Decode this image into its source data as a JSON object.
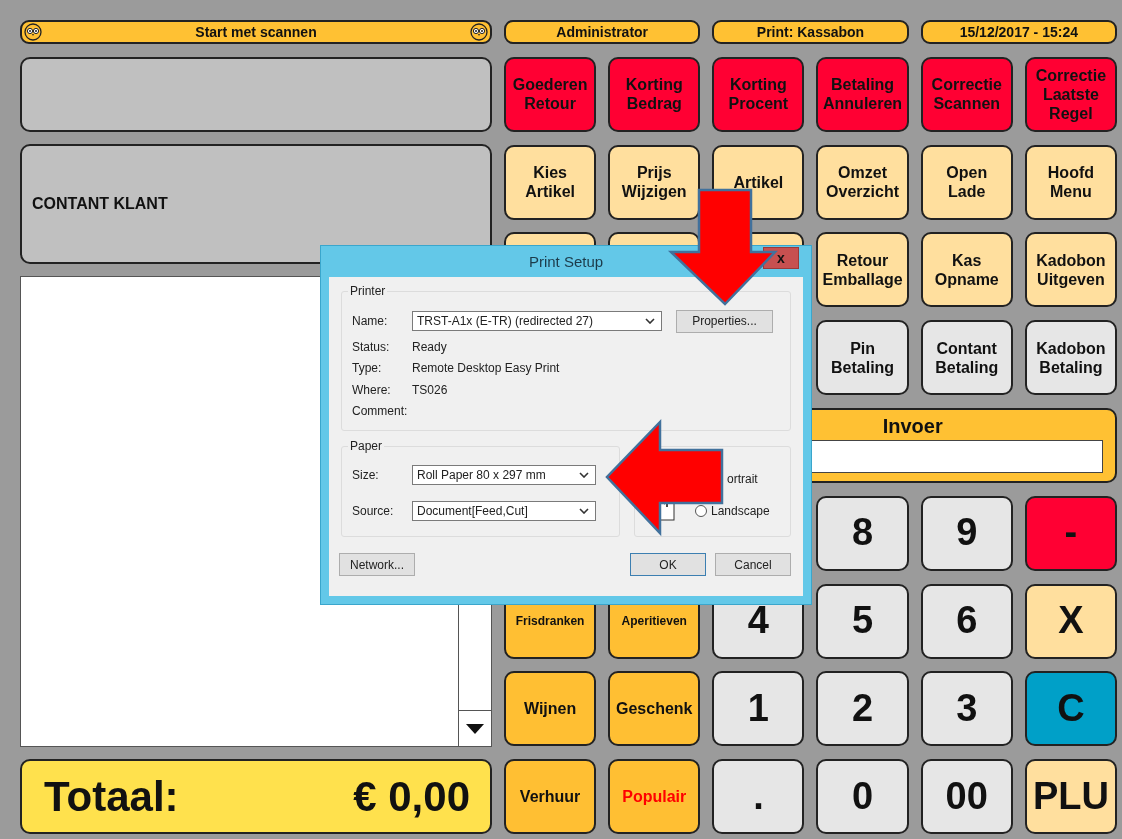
{
  "header": {
    "status": "Start met scannen",
    "user": "Administrator",
    "printer": "Print: Kassabon",
    "datetime": "15/12/2017 - 15:24"
  },
  "customer": "CONTANT KLANT",
  "total": {
    "label": "Totaal:",
    "amount": "€ 0,00"
  },
  "keypad_rows": [
    [
      {
        "kind": "command",
        "label": "Goederen\nRetour",
        "color": "#ff0033"
      },
      {
        "kind": "command",
        "label": "Korting\nBedrag",
        "color": "#ff0033"
      },
      {
        "kind": "command",
        "label": "Korting\nProcent",
        "color": "#ff0033"
      },
      {
        "kind": "command",
        "label": "Betaling\nAnnuleren",
        "color": "#ff0033"
      },
      {
        "kind": "command",
        "label": "Correctie\nScannen",
        "color": "#ff0033"
      },
      {
        "kind": "command",
        "label": "Correctie\nLaatste\nRegel",
        "color": "#ff0033"
      }
    ],
    [
      {
        "kind": "command",
        "label": "Kies\nArtikel",
        "color": "#ffdf9e"
      },
      {
        "kind": "command",
        "label": "Prijs\nWijzigen",
        "color": "#ffdf9e"
      },
      {
        "kind": "command",
        "label": "Artikel",
        "color": "#ffdf9e"
      },
      {
        "kind": "command",
        "label": "Omzet\nOverzicht",
        "color": "#ffdf9e"
      },
      {
        "kind": "command",
        "label": "Open\nLade",
        "color": "#ffdf9e"
      },
      {
        "kind": "command",
        "label": "Hoofd\nMenu",
        "color": "#ffdf9e"
      }
    ],
    [
      {
        "kind": "command",
        "color": "#ffdf9e"
      },
      {
        "kind": "command",
        "color": "#ffdf9e"
      },
      {
        "kind": "command",
        "color": "#ffdf9e"
      },
      {
        "kind": "command",
        "label": "Retour\nEmballage",
        "color": "#ffdf9e"
      },
      {
        "kind": "command",
        "label": "Kas\nOpname",
        "color": "#ffdf9e"
      },
      {
        "kind": "command",
        "label": "Kadobon\nUitgeven",
        "color": "#ffdf9e"
      }
    ],
    [
      null,
      null,
      null,
      {
        "kind": "command",
        "label": "Pin\nBetaling",
        "color": "#e6e6e6"
      },
      {
        "kind": "command",
        "label": "Contant\nBetaling",
        "color": "#e6e6e6"
      },
      {
        "kind": "command",
        "label": "Kadobon\nBetaling",
        "color": "#e6e6e6"
      }
    ],
    [
      null,
      null,
      {
        "kind": "input",
        "label": "Invoer"
      }
    ],
    [
      null,
      null,
      null,
      {
        "kind": "key",
        "label": "8",
        "color": "#e6e6e6"
      },
      {
        "kind": "key",
        "label": "9",
        "color": "#e6e6e6"
      },
      {
        "kind": "key",
        "label": "-",
        "color": "#ff0033"
      }
    ],
    [
      {
        "kind": "small",
        "label": "Frisdranken",
        "color": "#ffbf33"
      },
      {
        "kind": "small",
        "label": "Aperitieven",
        "color": "#ffbf33"
      },
      {
        "kind": "key",
        "label": "4",
        "color": "#e6e6e6"
      },
      {
        "kind": "key",
        "label": "5",
        "color": "#e6e6e6"
      },
      {
        "kind": "key",
        "label": "6",
        "color": "#e6e6e6"
      },
      {
        "kind": "key",
        "label": "X",
        "color": "#ffdf9e"
      }
    ],
    [
      {
        "kind": "command",
        "label": "Wijnen",
        "color": "#ffbf33"
      },
      {
        "kind": "command",
        "label": "Geschenk",
        "color": "#ffbf33"
      },
      {
        "kind": "key",
        "label": "1",
        "color": "#e6e6e6"
      },
      {
        "kind": "key",
        "label": "2",
        "color": "#e6e6e6"
      },
      {
        "kind": "key",
        "label": "3",
        "color": "#e6e6e6"
      },
      {
        "kind": "key",
        "label": "C",
        "color": "#00a0c8"
      }
    ],
    [
      {
        "kind": "command",
        "label": "Verhuur",
        "color": "#ffbf33"
      },
      {
        "kind": "command",
        "label": "Populair",
        "color": "#ffbf33",
        "alert": true
      },
      {
        "kind": "key",
        "label": ".",
        "color": "#e6e6e6"
      },
      {
        "kind": "key",
        "label": "0",
        "color": "#e6e6e6"
      },
      {
        "kind": "key",
        "label": "00",
        "color": "#e6e6e6"
      },
      {
        "kind": "key",
        "label": "PLU",
        "color": "#ffdf9e"
      }
    ]
  ],
  "dialog": {
    "title": "Print Setup",
    "close": "x",
    "printer": {
      "legend": "Printer",
      "name_label": "Name:",
      "name_value": "TRST-A1x (E-TR) (redirected 27)",
      "properties": "Properties...",
      "info": [
        {
          "label": "Status:",
          "value": "Ready"
        },
        {
          "label": "Type:",
          "value": "Remote Desktop Easy Print"
        },
        {
          "label": "Where:",
          "value": "TS026"
        },
        {
          "label": "Comment:"
        }
      ]
    },
    "paper": {
      "legend": "Paper",
      "size_label": "Size:",
      "size_value": "Roll Paper 80 x 297 mm",
      "source_label": "Source:",
      "source_value": "Document[Feed,Cut]"
    },
    "orientation": {
      "options": [
        {
          "label": "ortrait"
        },
        {
          "label": "Landscape",
          "selected": false
        }
      ]
    },
    "buttons": [
      {
        "label": "Network...",
        "kind": "left"
      },
      {
        "label": "OK",
        "kind": "default"
      },
      {
        "label": "Cancel",
        "kind": "normal"
      }
    ]
  }
}
